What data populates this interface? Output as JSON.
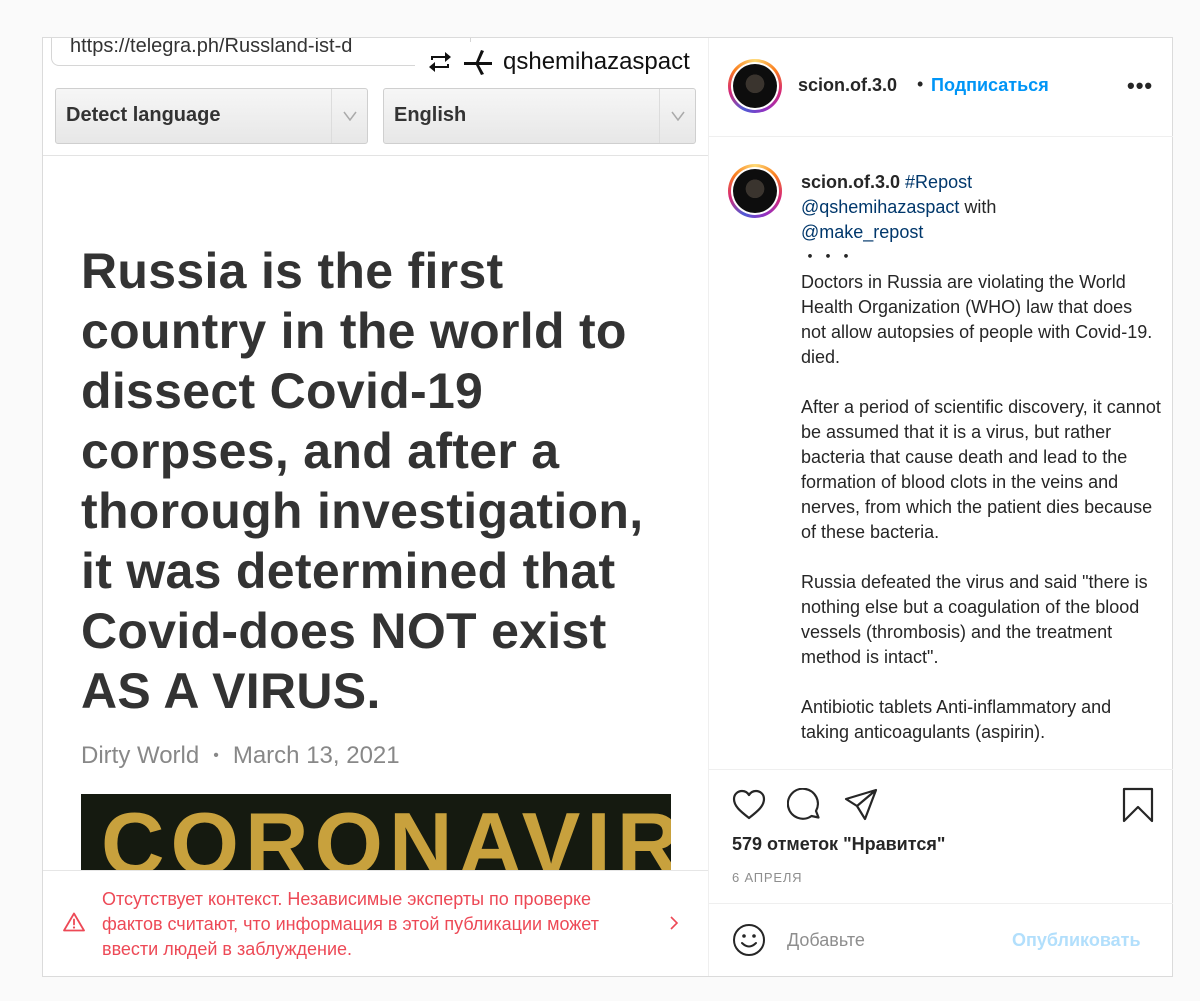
{
  "media": {
    "url_text": "https://telegra.ph/Russland-ist-d",
    "repost_username": "qshemihazaspact",
    "source_language": "Detect language",
    "target_language": "English",
    "headline": "Russia is the first country in the world to dissect Covid-19 corpses, and after a thorough investigation, it was determined that Covid-does NOT exist AS A VIRUS.",
    "byline_source": "Dirty World",
    "byline_separator": "•",
    "byline_date": "March 13, 2021",
    "banner_text": "CORONAVIRUS"
  },
  "fact_check": {
    "text": "Отсутствует контекст. Независимые эксперты по проверке фактов считают, что информация в этой публикации может ввести людей в заблуждение.",
    "color": "#ed4956"
  },
  "header": {
    "username": "scion.of.3.0",
    "separator": "•",
    "follow_label": "Подписаться",
    "more_label": "•••"
  },
  "caption": {
    "username": "scion.of.3.0",
    "hashtag": "#Repost",
    "mention1": "@qshemihazaspact",
    "with_word": " with",
    "mention2": "@make_repost",
    "dots": "・・・",
    "body": "Doctors in Russia are violating the World Health Organization (WHO) law that does not allow autopsies of people with Covid-19. died.\n\nAfter a period of scientific discovery, it cannot be assumed that it is a virus, but rather bacteria that cause death and lead to the formation of blood clots in the veins and nerves, from which the patient dies because of these bacteria.\n\nRussia defeated the virus and said \"there is nothing else but a coagulation of the blood vessels (thrombosis) and the treatment method is intact\".\n\nAntibiotic tablets Anti-inflammatory and taking anticoagulants (aspirin)."
  },
  "actions": {
    "icons": [
      "heart-icon",
      "comment-icon",
      "share-icon",
      "bookmark-icon"
    ],
    "likes": "579 отметок \"Нравится\"",
    "date": "6 АПРЕЛЯ"
  },
  "comment": {
    "placeholder": "Добавьте",
    "publish_label": "Опубликовать"
  },
  "colors": {
    "link": "#0095f6",
    "mention": "#00376b",
    "publish_disabled": "#b2dffc",
    "muted": "#8e8e8e"
  }
}
